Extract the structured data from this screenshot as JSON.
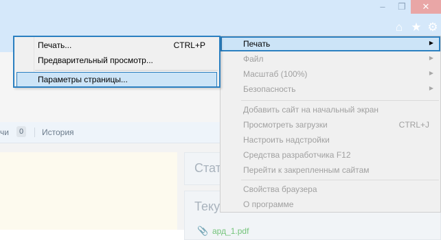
{
  "window": {
    "minimize_glyph": "–",
    "restore_glyph": "❐",
    "close_glyph": "✕",
    "home_glyph": "⌂",
    "favorites_glyph": "★",
    "tools_glyph": "⚙"
  },
  "page": {
    "tabs": [
      {
        "label": "чи",
        "count": "0"
      },
      {
        "label": "История"
      }
    ],
    "card_status_title": "Стат",
    "card_current_title": "Теку",
    "file_link": "ард_1.pdf"
  },
  "tools_menu": {
    "items": [
      {
        "label": "Печать",
        "has_submenu": true,
        "active": true
      },
      {
        "label": "Файл",
        "has_submenu": true
      },
      {
        "label": "Масштаб (100%)",
        "has_submenu": true
      },
      {
        "label": "Безопасность",
        "has_submenu": true
      },
      {
        "label": "Добавить сайт на начальный экран"
      },
      {
        "label": "Просмотреть загрузки",
        "shortcut": "CTRL+J"
      },
      {
        "label": "Настроить надстройки"
      },
      {
        "label": "Средства разработчика F12"
      },
      {
        "label": "Перейти к закрепленным сайтам"
      },
      {
        "label": "Свойства браузера"
      },
      {
        "label": "О программе"
      }
    ],
    "arrow_glyph": "▶"
  },
  "print_submenu": {
    "items": [
      {
        "label": "Печать...",
        "shortcut": "CTRL+P"
      },
      {
        "label": "Предварительный просмотр..."
      },
      {
        "label": "Параметры страницы...",
        "highlighted": true
      }
    ]
  },
  "colors": {
    "accent": "#2a7fc0",
    "highlight": "#cce4f7",
    "chrome": "#d5e8fa"
  }
}
